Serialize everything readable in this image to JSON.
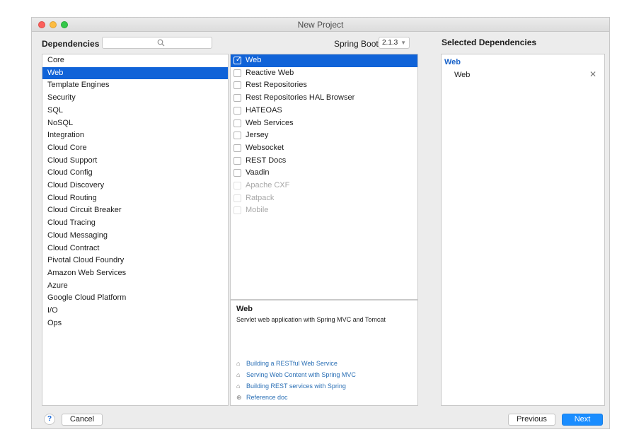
{
  "window": {
    "title": "New Project"
  },
  "header": {
    "dependencies_label": "Dependencies",
    "search": {
      "value": "",
      "icon": "search-icon"
    },
    "spring_boot_label": "Spring Boot",
    "spring_boot_version": "2.1.3"
  },
  "categories": {
    "selected": "Web",
    "items": [
      "Core",
      "Web",
      "Template Engines",
      "Security",
      "SQL",
      "NoSQL",
      "Integration",
      "Cloud Core",
      "Cloud Support",
      "Cloud Config",
      "Cloud Discovery",
      "Cloud Routing",
      "Cloud Circuit Breaker",
      "Cloud Tracing",
      "Cloud Messaging",
      "Cloud Contract",
      "Pivotal Cloud Foundry",
      "Amazon Web Services",
      "Azure",
      "Google Cloud Platform",
      "I/O",
      "Ops"
    ]
  },
  "dependencies": {
    "items": [
      {
        "label": "Web",
        "checked": true,
        "selected": true,
        "disabled": false
      },
      {
        "label": "Reactive Web",
        "checked": false,
        "selected": false,
        "disabled": false
      },
      {
        "label": "Rest Repositories",
        "checked": false,
        "selected": false,
        "disabled": false
      },
      {
        "label": "Rest Repositories HAL Browser",
        "checked": false,
        "selected": false,
        "disabled": false
      },
      {
        "label": "HATEOAS",
        "checked": false,
        "selected": false,
        "disabled": false
      },
      {
        "label": "Web Services",
        "checked": false,
        "selected": false,
        "disabled": false
      },
      {
        "label": "Jersey",
        "checked": false,
        "selected": false,
        "disabled": false
      },
      {
        "label": "Websocket",
        "checked": false,
        "selected": false,
        "disabled": false
      },
      {
        "label": "REST Docs",
        "checked": false,
        "selected": false,
        "disabled": false
      },
      {
        "label": "Vaadin",
        "checked": false,
        "selected": false,
        "disabled": false
      },
      {
        "label": "Apache CXF",
        "checked": false,
        "selected": false,
        "disabled": true
      },
      {
        "label": "Ratpack",
        "checked": false,
        "selected": false,
        "disabled": true
      },
      {
        "label": "Mobile",
        "checked": false,
        "selected": false,
        "disabled": true
      }
    ]
  },
  "description": {
    "title": "Web",
    "text": "Servlet web application with Spring MVC and Tomcat",
    "links": [
      {
        "label": "Building a RESTful Web Service",
        "icon": "guide-icon"
      },
      {
        "label": "Serving Web Content with Spring MVC",
        "icon": "guide-icon"
      },
      {
        "label": "Building REST services with Spring",
        "icon": "guide-icon"
      },
      {
        "label": "Reference doc",
        "icon": "reference-icon"
      }
    ]
  },
  "selected_dependencies": {
    "title": "Selected Dependencies",
    "group": "Web",
    "items": [
      "Web"
    ]
  },
  "footer": {
    "help_label": "?",
    "cancel_label": "Cancel",
    "previous_label": "Previous",
    "next_label": "Next"
  },
  "colors": {
    "selection": "#1063d8",
    "link": "#2a6fb5",
    "primary_button": "#1a8dff"
  }
}
